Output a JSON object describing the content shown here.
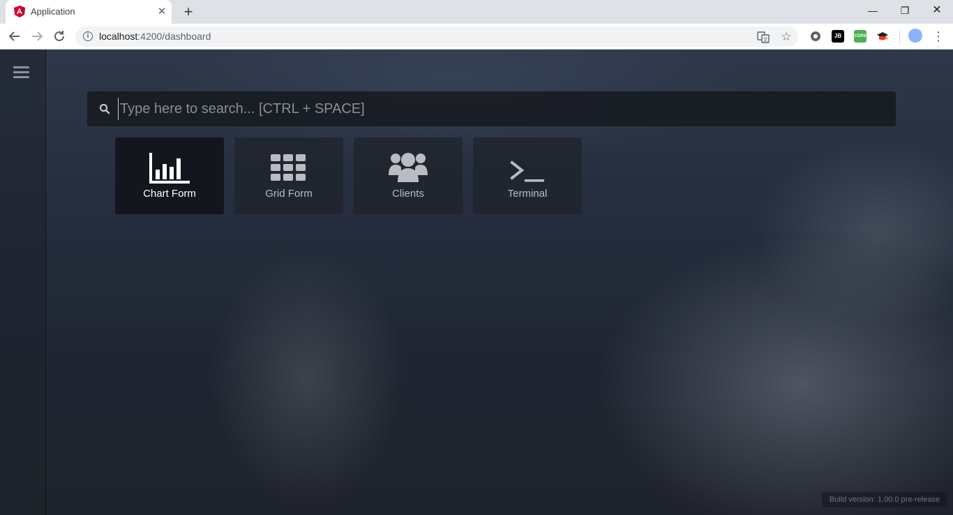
{
  "browser": {
    "tab_title": "Application",
    "url_host": "localhost",
    "url_port_path": ":4200/dashboard"
  },
  "extensions": [
    {
      "name": "settings-extension-icon"
    },
    {
      "name": "jb-extension-icon",
      "label": "JB"
    },
    {
      "name": "cors-extension-icon",
      "label": "CORS"
    },
    {
      "name": "graduation-cap-extension-icon"
    }
  ],
  "app": {
    "search": {
      "placeholder": "Type here to search... [CTRL + SPACE]"
    },
    "tiles": [
      {
        "label": "Chart Form",
        "icon": "bar-chart-icon",
        "active": true
      },
      {
        "label": "Grid Form",
        "icon": "grid-icon",
        "active": false
      },
      {
        "label": "Clients",
        "icon": "users-icon",
        "active": false
      },
      {
        "label": "Terminal",
        "icon": "terminal-icon",
        "active": false
      }
    ],
    "build_version": "Build version: 1.00.0 pre-release"
  },
  "colors": {
    "accent_angular": "#dd0031",
    "tile_active_bg": "#12151b"
  }
}
